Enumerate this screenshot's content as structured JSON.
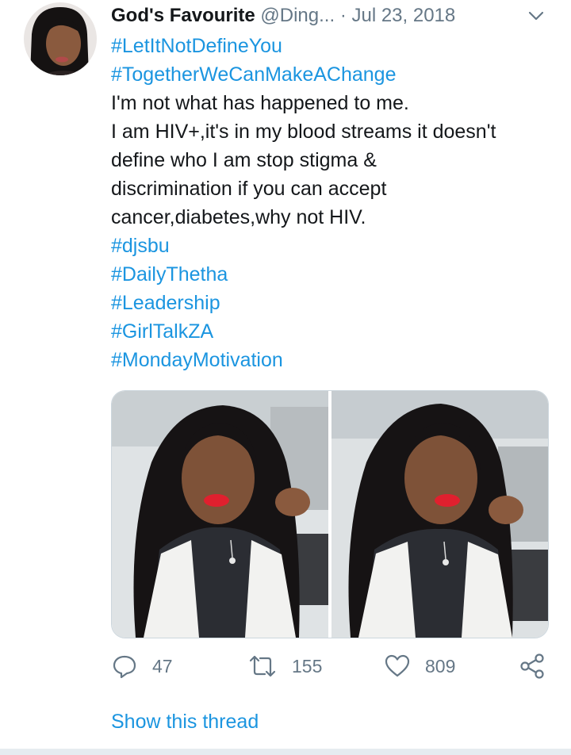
{
  "tweet": {
    "author_name": "God's Favourite",
    "handle": "@Ding...",
    "separator": "·",
    "date": "Jul 23, 2018",
    "lines": [
      {
        "text": "#LetItNotDefineYou",
        "hashtag": true
      },
      {
        "text": "#TogetherWeCanMakeAChange",
        "hashtag": true
      },
      {
        "text": "I'm not what has happened to me.",
        "hashtag": false
      },
      {
        "text": "I am HIV+,it's in my blood streams it doesn't",
        "hashtag": false
      },
      {
        "text": "define who I am stop stigma &",
        "hashtag": false
      },
      {
        "text": "discrimination if you can accept",
        "hashtag": false
      },
      {
        "text": "cancer,diabetes,why not HIV.",
        "hashtag": false
      },
      {
        "text": "#djsbu",
        "hashtag": true
      },
      {
        "text": "#DailyThetha",
        "hashtag": true
      },
      {
        "text": "#Leadership",
        "hashtag": true
      },
      {
        "text": "#GirlTalkZA",
        "hashtag": true
      },
      {
        "text": "#MondayMotivation",
        "hashtag": true
      }
    ],
    "actions": {
      "reply_count": "47",
      "retweet_count": "155",
      "like_count": "809"
    },
    "show_thread": "Show this thread"
  },
  "icons": {
    "header_menu": "chevron-down-icon",
    "reply": "reply-icon",
    "retweet": "retweet-icon",
    "like": "heart-icon",
    "share": "share-icon"
  },
  "colors": {
    "link": "#1b95e0",
    "muted": "#657786",
    "text": "#14171a",
    "lipstick": "#e0202e"
  }
}
